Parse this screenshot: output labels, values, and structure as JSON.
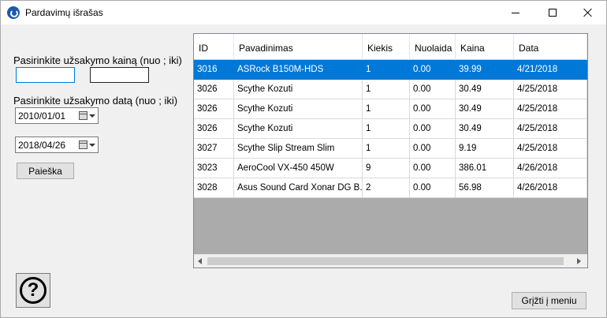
{
  "window": {
    "title": "Pardavimų išrašas"
  },
  "filters": {
    "price_label": "Pasirinkite užsakymo kainą (nuo ; iki)",
    "price_from": "",
    "price_to": "",
    "date_label": "Pasirinkite užsakymo datą (nuo ; iki)",
    "date_from": "2010/01/01",
    "date_to": "2018/04/26",
    "search_button": "Paieška"
  },
  "table": {
    "columns": [
      "ID",
      "Pavadinimas",
      "Kiekis",
      "Nuolaida",
      "Kaina",
      "Data"
    ],
    "rows": [
      [
        "3016",
        "ASRock B150M-HDS",
        "1",
        "0.00",
        "39.99",
        "4/21/2018"
      ],
      [
        "3026",
        "Scythe Kozuti",
        "1",
        "0.00",
        "30.49",
        "4/25/2018"
      ],
      [
        "3026",
        "Scythe Kozuti",
        "1",
        "0.00",
        "30.49",
        "4/25/2018"
      ],
      [
        "3026",
        "Scythe Kozuti",
        "1",
        "0.00",
        "30.49",
        "4/25/2018"
      ],
      [
        "3027",
        "Scythe Slip Stream Slim",
        "1",
        "0.00",
        "9.19",
        "4/25/2018"
      ],
      [
        "3023",
        "AeroCool VX-450 450W",
        "9",
        "0.00",
        "386.01",
        "4/26/2018"
      ],
      [
        "3028",
        "Asus Sound Card Xonar DG B...",
        "2",
        "0.00",
        "56.98",
        "4/26/2018"
      ]
    ],
    "selected_row": 0
  },
  "footer": {
    "back_button": "Grįžti į meniu",
    "help_glyph": "?"
  }
}
